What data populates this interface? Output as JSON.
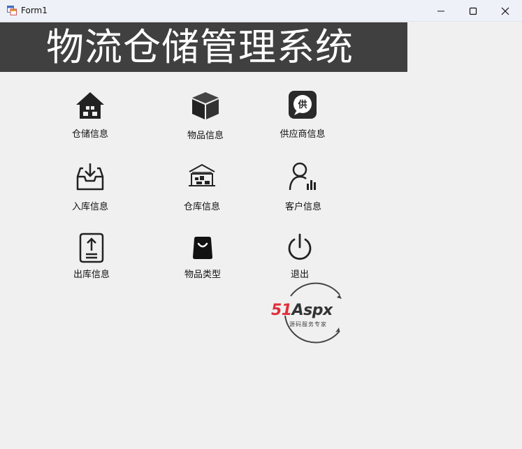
{
  "window": {
    "title": "Form1",
    "minimize_icon": "minimize-icon",
    "maximize_icon": "maximize-icon",
    "close_icon": "close-icon"
  },
  "banner": {
    "title": "物流仓储管理系统",
    "background": "#404040"
  },
  "menu": [
    {
      "label": "仓储信息",
      "icon": "warehouse-house-icon"
    },
    {
      "label": "物品信息",
      "icon": "cube-box-icon"
    },
    {
      "label": "供应商信息",
      "icon": "supplier-badge-icon"
    },
    {
      "label": "入库信息",
      "icon": "inbox-download-icon"
    },
    {
      "label": "仓库信息",
      "icon": "warehouse-building-icon"
    },
    {
      "label": "客户信息",
      "icon": "customer-chart-icon"
    },
    {
      "label": "出库信息",
      "icon": "outbound-upload-icon"
    },
    {
      "label": "物品类型",
      "icon": "bag-icon"
    },
    {
      "label": "退出",
      "icon": "power-icon"
    }
  ],
  "watermark": {
    "brand_num": "51",
    "brand_text": "Aspx",
    "tagline": "源码服务专家",
    "num_color": "#e0303a",
    "x_color": "#2e9a3a"
  }
}
